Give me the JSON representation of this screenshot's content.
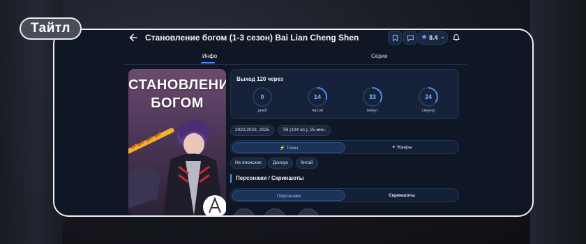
{
  "badge": {
    "label": "Тайтл"
  },
  "header": {
    "title": "Становление богом (1-3 сезон) Bai Lian Cheng Shen",
    "rating": "8.4"
  },
  "tabs": [
    {
      "label": "Инфо",
      "active": true
    },
    {
      "label": "Серии",
      "active": false
    }
  ],
  "poster": {
    "title_line1": "СТАНОВЛЕНИЕ",
    "title_line2": "БОГОМ"
  },
  "countdown": {
    "title": "Выход 120 через",
    "units": [
      {
        "value": "0",
        "label": "дней"
      },
      {
        "value": "14",
        "label": "часов"
      },
      {
        "value": "33",
        "label": "минут"
      },
      {
        "value": "24",
        "label": "секунд"
      }
    ]
  },
  "meta": {
    "years": "2022,2023, 2025",
    "format": "ТВ (104 эп.), 25 мин."
  },
  "topic_tabs": {
    "themes": "Темы",
    "genres": "Жанры"
  },
  "tags": [
    "Не японское",
    "Донхуа",
    "Китай"
  ],
  "characters": {
    "title": "Персонажи / Скриншоты",
    "tab_characters": "Персонажи",
    "tab_screenshots": "Скриншоты"
  },
  "colors": {
    "accent": "#4f8cff",
    "background": "#0f1624",
    "panel": "#15223a"
  }
}
